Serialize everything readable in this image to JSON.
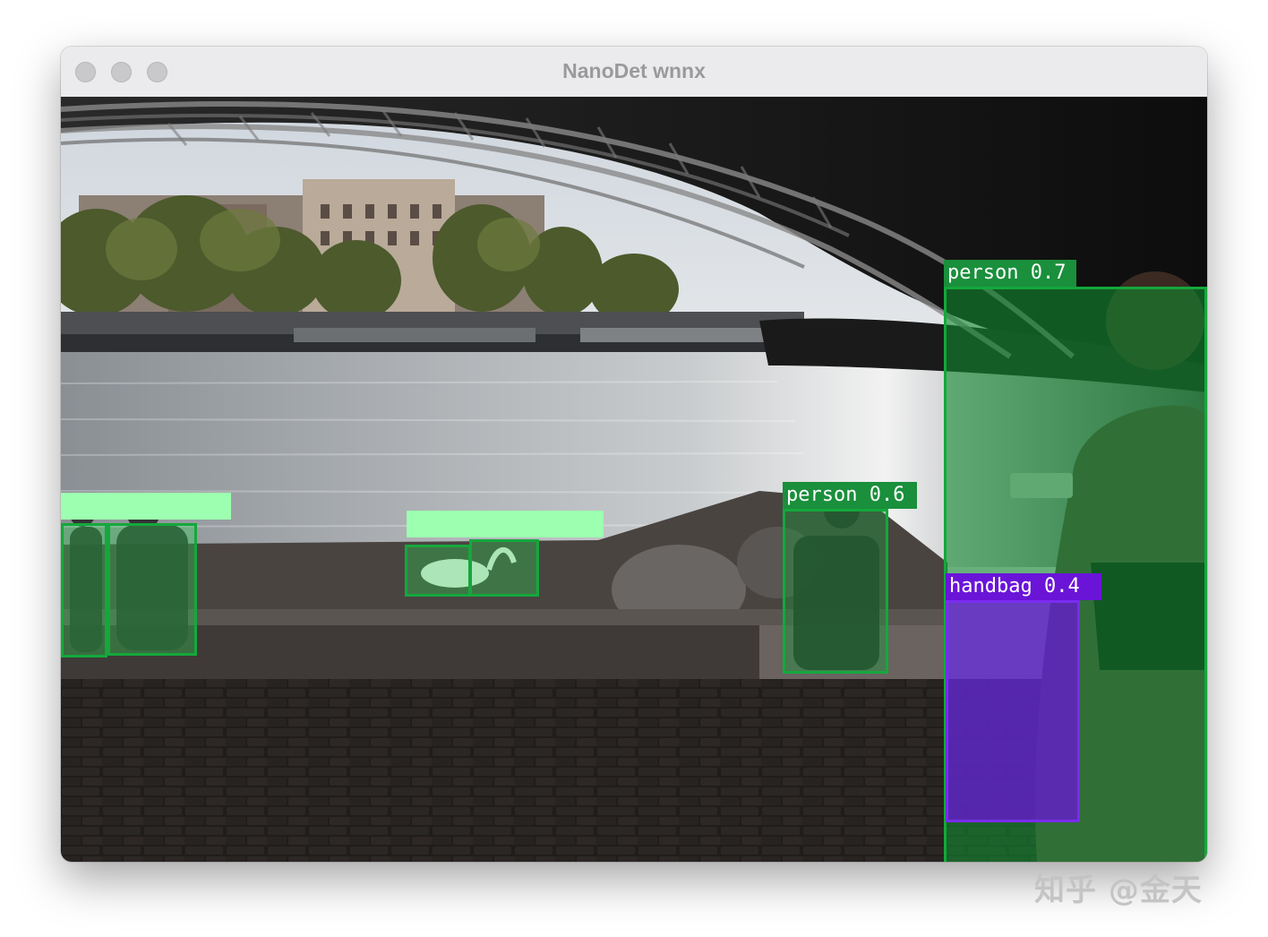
{
  "window": {
    "title": "NanoDet wnnx"
  },
  "detections": [
    {
      "label": "",
      "color": "#7dff9a",
      "box_color": "#14a83c",
      "label_text_color": "#ffffff",
      "fill": "#2bd14f",
      "fill_opacity": 0.35
    },
    {
      "label": "",
      "color": "#7dff9a",
      "box_color": "#14a83c",
      "label_text_color": "#ffffff",
      "fill": "#2bd14f",
      "fill_opacity": 0.35
    },
    {
      "label": "",
      "color": "#7dff9a",
      "box_color": "#14a83c",
      "label_text_color": "#ffffff",
      "fill": "#2bd14f",
      "fill_opacity": 0.35
    },
    {
      "label": "",
      "color": "#7dff9a",
      "box_color": "#14a83c",
      "label_text_color": "#ffffff",
      "fill": "#2bd14f",
      "fill_opacity": 0.35
    },
    {
      "label": "person 0.6",
      "color": "#1a8f3c",
      "box_color": "#14a83c",
      "label_text_color": "#ffffff",
      "fill": "#1a9a3a",
      "fill_opacity": 0.4
    },
    {
      "label": "person 0.7",
      "color": "#1a8f3c",
      "box_color": "#14a83c",
      "label_text_color": "#ffffff",
      "fill": "#128a30",
      "fill_opacity": 0.6
    },
    {
      "label": "handbag 0.4",
      "color": "#6a14d8",
      "box_color": "#7a2cf0",
      "label_text_color": "#ffffff",
      "fill": "#6a14d8",
      "fill_opacity": 0.75
    }
  ],
  "watermark": {
    "text": "知乎 @金天"
  }
}
